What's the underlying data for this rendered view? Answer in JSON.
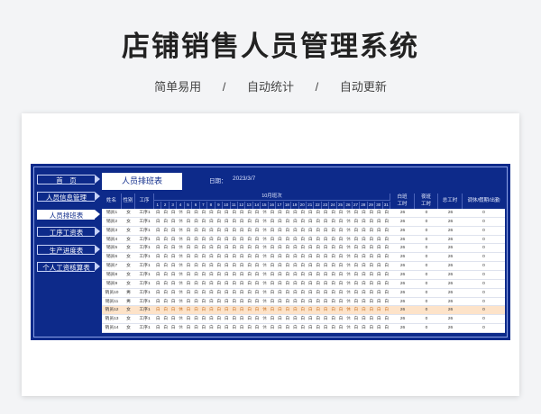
{
  "page": {
    "title": "店铺销售人员管理系统",
    "subtitle": [
      "简单易用",
      "/",
      "自动统计",
      "/",
      "自动更新"
    ]
  },
  "nav": [
    {
      "label": "首　页",
      "active": false
    },
    {
      "label": "人员信息管理",
      "active": false
    },
    {
      "label": "人员排班表",
      "active": true
    },
    {
      "label": "工序工资表",
      "active": false
    },
    {
      "label": "生产进度表",
      "active": false
    },
    {
      "label": "个人工资核算表",
      "active": false
    }
  ],
  "sheet": {
    "tab_title": "人员排班表",
    "date_label": "日期：",
    "date_value": "2023/3/7",
    "month_title": "10月班次",
    "headers": {
      "name": "姓名",
      "gender": "性别",
      "type": "工序",
      "day_total": "白班\n工时",
      "night_total": "夜班\n工时",
      "total": "总工时",
      "remark": "调休/假期/出勤"
    },
    "days": [
      "1",
      "2",
      "3",
      "4",
      "5",
      "6",
      "7",
      "8",
      "9",
      "10",
      "11",
      "12",
      "13",
      "14",
      "15",
      "16",
      "17",
      "18",
      "19",
      "20",
      "21",
      "22",
      "23",
      "24",
      "25",
      "26",
      "27",
      "28",
      "29",
      "30",
      "31"
    ],
    "rest_days": [
      3,
      14,
      25
    ],
    "shift_symbols": {
      "work": "白",
      "rest": "休"
    },
    "rows": [
      {
        "name": "销员1",
        "gender": "女",
        "type": "工序1",
        "day": "26",
        "night": "0",
        "total": "26",
        "remark": "0"
      },
      {
        "name": "销员2",
        "gender": "女",
        "type": "工序1",
        "day": "26",
        "night": "0",
        "total": "26",
        "remark": "0"
      },
      {
        "name": "销员3",
        "gender": "女",
        "type": "工序1",
        "day": "26",
        "night": "0",
        "total": "26",
        "remark": "0"
      },
      {
        "name": "销员4",
        "gender": "女",
        "type": "工序1",
        "day": "26",
        "night": "0",
        "total": "26",
        "remark": "0"
      },
      {
        "name": "销员5",
        "gender": "女",
        "type": "工序1",
        "day": "26",
        "night": "0",
        "total": "26",
        "remark": "0"
      },
      {
        "name": "销员6",
        "gender": "女",
        "type": "工序1",
        "day": "26",
        "night": "0",
        "total": "26",
        "remark": "0"
      },
      {
        "name": "销员7",
        "gender": "女",
        "type": "工序1",
        "day": "26",
        "night": "0",
        "total": "26",
        "remark": "0"
      },
      {
        "name": "销员8",
        "gender": "女",
        "type": "工序1",
        "day": "26",
        "night": "0",
        "total": "26",
        "remark": "0"
      },
      {
        "name": "销员9",
        "gender": "女",
        "type": "工序1",
        "day": "26",
        "night": "0",
        "total": "26",
        "remark": "0"
      },
      {
        "name": "销员10",
        "gender": "男",
        "type": "工序1",
        "day": "26",
        "night": "0",
        "total": "26",
        "remark": "0"
      },
      {
        "name": "销员11",
        "gender": "男",
        "type": "工序1",
        "day": "26",
        "night": "0",
        "total": "26",
        "remark": "0"
      },
      {
        "name": "销员12",
        "gender": "女",
        "type": "工序1",
        "day": "26",
        "night": "0",
        "total": "26",
        "remark": "0",
        "highlight": true
      },
      {
        "name": "销员13",
        "gender": "女",
        "type": "工序1",
        "day": "26",
        "night": "0",
        "total": "26",
        "remark": "0"
      },
      {
        "name": "销员14",
        "gender": "女",
        "type": "工序1",
        "day": "26",
        "night": "0",
        "total": "26",
        "remark": "0"
      }
    ]
  },
  "colors": {
    "panel": "#0d2a8a",
    "highlight": "#fde3c9"
  }
}
